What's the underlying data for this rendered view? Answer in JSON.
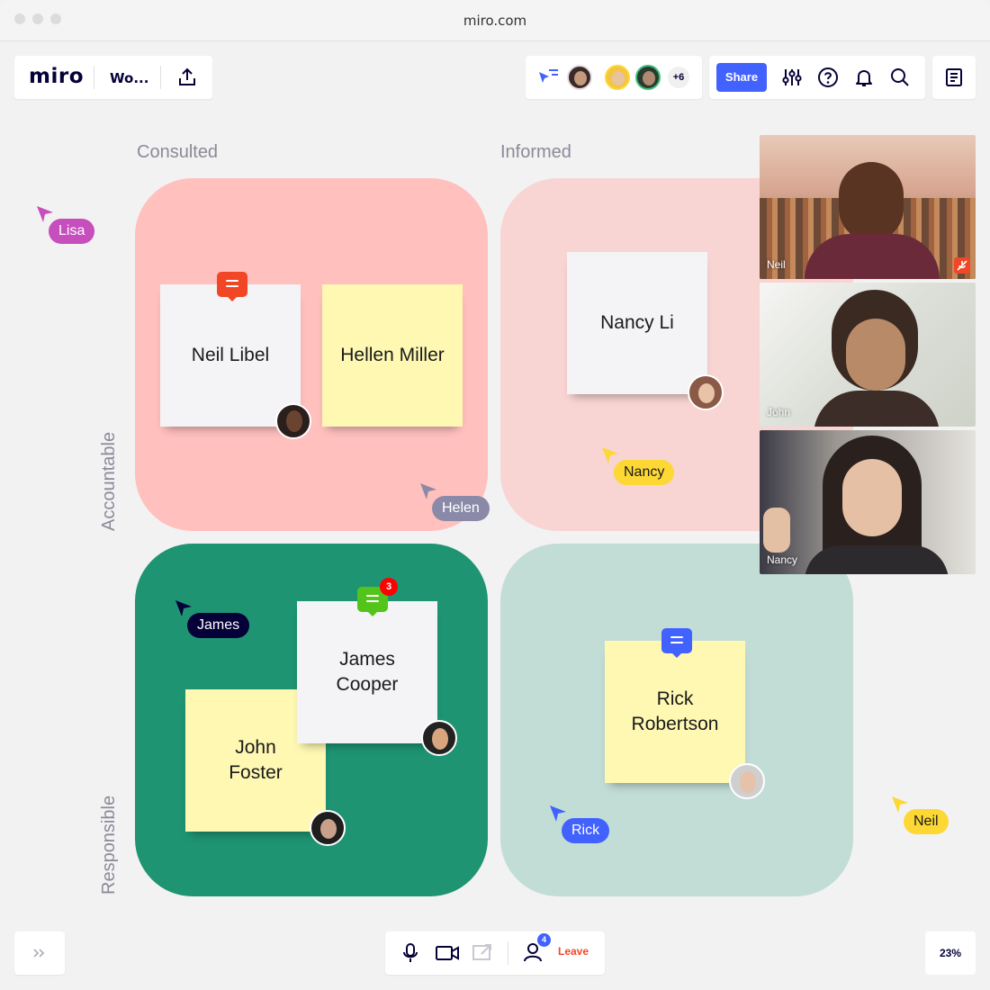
{
  "window": {
    "url": "miro.com"
  },
  "toolbar": {
    "logo": "miro",
    "board_name": "Wo...",
    "share_label": "Share",
    "collaborators_more": "+6"
  },
  "matrix": {
    "columns": [
      "Consulted",
      "Informed"
    ],
    "rows": [
      "Accountable",
      "Responsible"
    ]
  },
  "stickies": [
    {
      "text": "Neil Libel",
      "color": "white"
    },
    {
      "text": "Hellen Miller",
      "color": "yellow"
    },
    {
      "text": "Nancy Li",
      "color": "white"
    },
    {
      "text": "James Cooper",
      "color": "white"
    },
    {
      "text": "John Foster",
      "color": "yellow"
    },
    {
      "text": "Rick Robertson",
      "color": "yellow"
    }
  ],
  "comments": [
    {
      "color": "#f24726",
      "badge": ""
    },
    {
      "color": "#52c41a",
      "badge": "3"
    },
    {
      "color": "#4262ff",
      "badge": ""
    }
  ],
  "cursors": [
    {
      "name": "Lisa",
      "color": "#c64ebd"
    },
    {
      "name": "Helen",
      "color": "#8a8aa8"
    },
    {
      "name": "Nancy",
      "color": "#fdd835"
    },
    {
      "name": "James",
      "color": "#050038"
    },
    {
      "name": "Rick",
      "color": "#4262ff"
    },
    {
      "name": "Neil",
      "color": "#fdd835"
    }
  ],
  "videos": [
    {
      "name": "Neil"
    },
    {
      "name": "John"
    },
    {
      "name": "Nancy"
    }
  ],
  "bottom_bar": {
    "participants_badge": "4",
    "leave_label": "Leave",
    "zoom": "23%"
  },
  "colors": {
    "accent": "#4262ff",
    "quad_consulted_accountable": "#ffc0be",
    "quad_informed_accountable": "#f8d4d3",
    "quad_consulted_responsible": "#1e9472",
    "quad_informed_responsible": "#c2ddd6"
  }
}
